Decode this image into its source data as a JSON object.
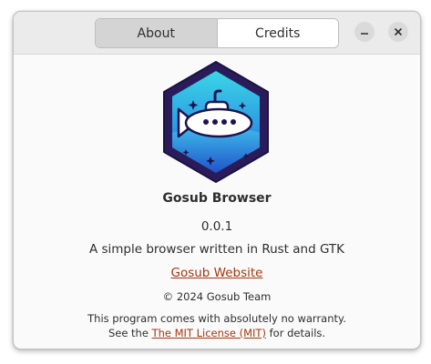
{
  "tabs": [
    {
      "label": "About",
      "active": true
    },
    {
      "label": "Credits",
      "active": false
    }
  ],
  "window_controls": {
    "minimize_icon": "minimize-icon",
    "close_icon": "close-icon"
  },
  "app": {
    "name": "Gosub Browser",
    "version": "0.0.1",
    "comments": "A simple browser written in Rust and GTK",
    "website_label": "Gosub Website",
    "copyright": "© 2024 Gosub Team",
    "license_line1": "This program comes with absolutely no warranty.",
    "license_prefix": "See the",
    "license_link": "The MIT License (MIT)",
    "license_suffix": "for details.",
    "logo_icon": "submarine-logo-icon"
  },
  "colors": {
    "link": "#a8350f",
    "logo_border": "#2a1c5a",
    "logo_fill_top": "#35d6e8",
    "logo_fill_bottom": "#2a64dc"
  }
}
